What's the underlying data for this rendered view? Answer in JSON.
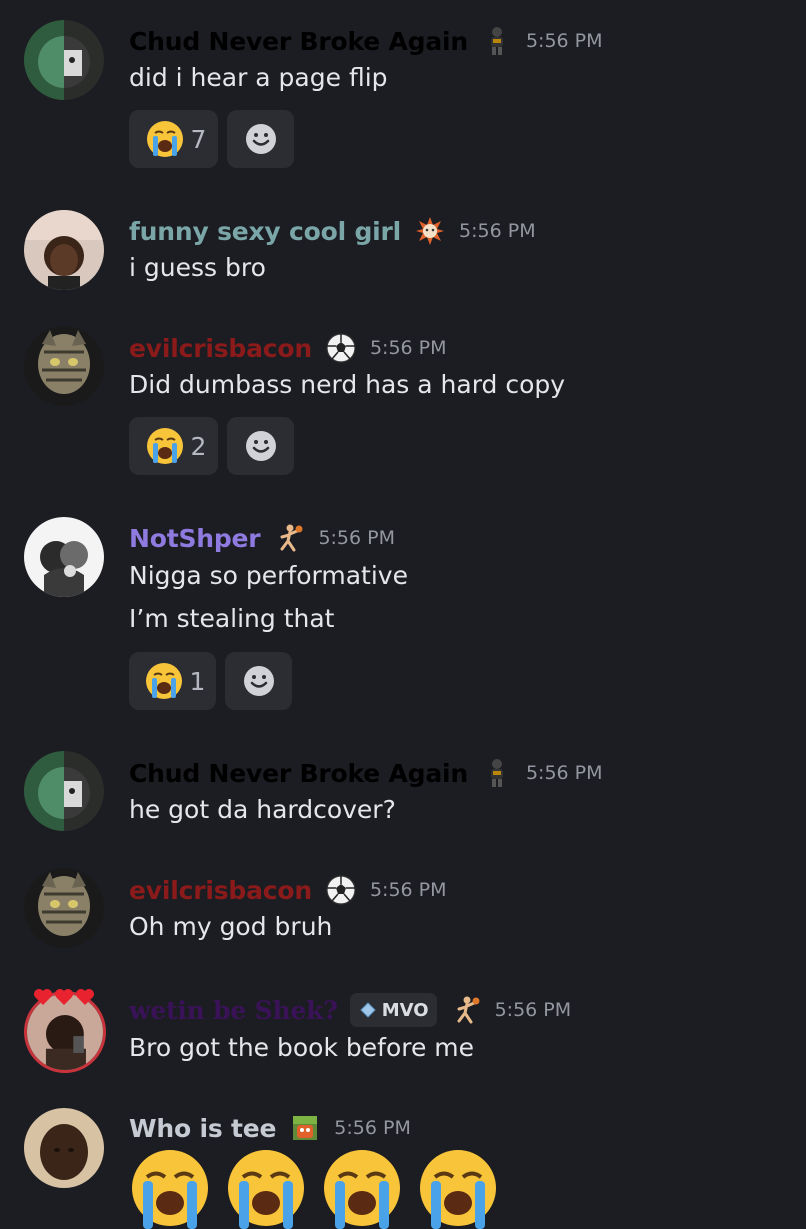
{
  "theme": {
    "background": "#1c1d22",
    "reaction_bg": "#2c2d33",
    "timestamp": "#9497a0"
  },
  "messages": [
    {
      "author": "Chud Never Broke Again",
      "name_color": "#000000",
      "badge_icon": "football-player-icon",
      "time": "5:56 PM",
      "lines": [
        "did i hear a page flip"
      ],
      "reaction": {
        "emoji": "loudly-crying-face",
        "count": "7"
      }
    },
    {
      "author": "funny sexy cool girl",
      "name_color": "#7aa6a8",
      "badge_icon": "sun-badge-icon",
      "time": "5:56 PM",
      "lines": [
        "i guess bro"
      ]
    },
    {
      "author": "evilcrisbacon",
      "name_color": "#8b1a1a",
      "badge_icon": "soccer-ball-icon",
      "time": "5:56 PM",
      "lines": [
        "Did dumbass nerd has a hard copy"
      ],
      "reaction": {
        "emoji": "loudly-crying-face",
        "count": "2"
      }
    },
    {
      "author": "NotShper",
      "name_color": "#8f7be0",
      "badge_icon": "basketball-player-icon",
      "time": "5:56 PM",
      "lines": [
        "Nigga so performative",
        "I’m stealing that"
      ],
      "reaction": {
        "emoji": "loudly-crying-face",
        "count": "1"
      }
    },
    {
      "author": "Chud Never Broke Again",
      "name_color": "#000000",
      "badge_icon": "football-player-icon",
      "time": "5:56 PM",
      "lines": [
        "he got da hardcover?"
      ]
    },
    {
      "author": "evilcrisbacon",
      "name_color": "#8b1a1a",
      "badge_icon": "soccer-ball-icon",
      "time": "5:56 PM",
      "lines": [
        "Oh my god bruh"
      ]
    },
    {
      "author": "wetin be Shek?",
      "name_color": "#3a1257",
      "tag": "MVO",
      "badge_icon": "basketball-player-icon",
      "time": "5:56 PM",
      "lines": [
        "Bro got the book before me"
      ]
    },
    {
      "author": "Who is tee",
      "name_color": "#c5cad3",
      "badge_icon": "minecraft-block-icon",
      "time": "5:56 PM",
      "big_emoji_count": 4
    }
  ]
}
